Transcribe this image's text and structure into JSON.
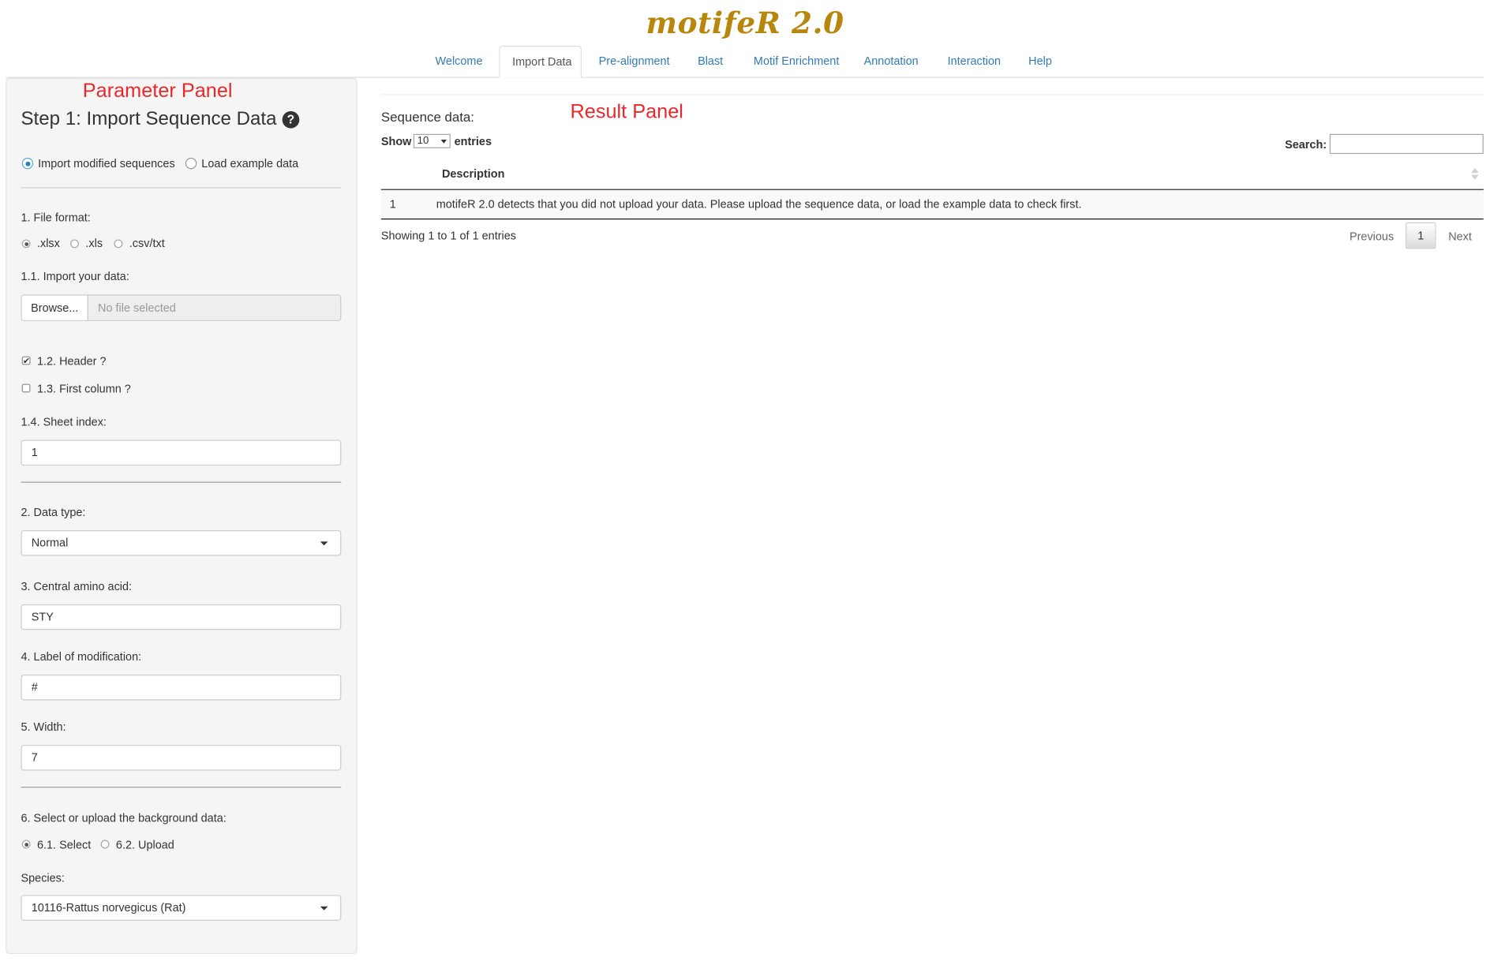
{
  "app": {
    "title": "motifeR 2.0"
  },
  "nav": {
    "tabs": [
      "Welcome",
      "Import Data",
      "Pre-alignment",
      "Blast",
      "Motif Enrichment",
      "Annotation",
      "Interaction",
      "Help"
    ],
    "active_tab": "Import Data"
  },
  "annotations": {
    "parameter_panel": "Parameter Panel",
    "result_panel": "Result Panel"
  },
  "sidebar": {
    "step_title": "Step 1: Import Sequence Data",
    "help_icon": "question-circle-icon",
    "mode_options": [
      "Import modified sequences",
      "Load example data"
    ],
    "mode_selected": "Import modified sequences",
    "file_format_label": "1. File format:",
    "file_format_options": [
      ".xlsx",
      ".xls",
      ".csv/txt"
    ],
    "file_format_selected": ".xlsx",
    "import_label": "1.1. Import your data:",
    "browse_button": "Browse...",
    "file_placeholder": "No file selected",
    "header_label": "1.2. Header ?",
    "header_checked": true,
    "first_column_label": "1.3. First column ?",
    "first_column_checked": false,
    "sheet_index_label": "1.4. Sheet index:",
    "sheet_index_value": "1",
    "data_type_label": "2. Data type:",
    "data_type_value": "Normal",
    "central_aa_label": "3. Central amino acid:",
    "central_aa_value": "STY",
    "mod_label_label": "4. Label of modification:",
    "mod_label_value": "#",
    "width_label": "5. Width:",
    "width_value": "7",
    "background_label": "6. Select or upload the background data:",
    "background_options": [
      "6.1. Select",
      "6.2. Upload"
    ],
    "background_selected": "6.1. Select",
    "species_label": "Species:",
    "species_value": "10116-Rattus norvegicus (Rat)"
  },
  "result": {
    "title": "Sequence data:",
    "show_label": "Show",
    "entries_value": "10",
    "entries_label": "entries",
    "search_label": "Search:",
    "search_value": "",
    "column_header": "Description",
    "rows": [
      {
        "index": "1",
        "description": "motifeR 2.0 detects that you did not upload your data. Please upload the sequence data, or load the example data to check first."
      }
    ],
    "info": "Showing 1 to 1 of 1 entries",
    "pagination": {
      "previous": "Previous",
      "current": "1",
      "next": "Next"
    }
  },
  "colors": {
    "title": "#b8860b",
    "annotation": "#e8282a",
    "link": "#337ab7"
  }
}
